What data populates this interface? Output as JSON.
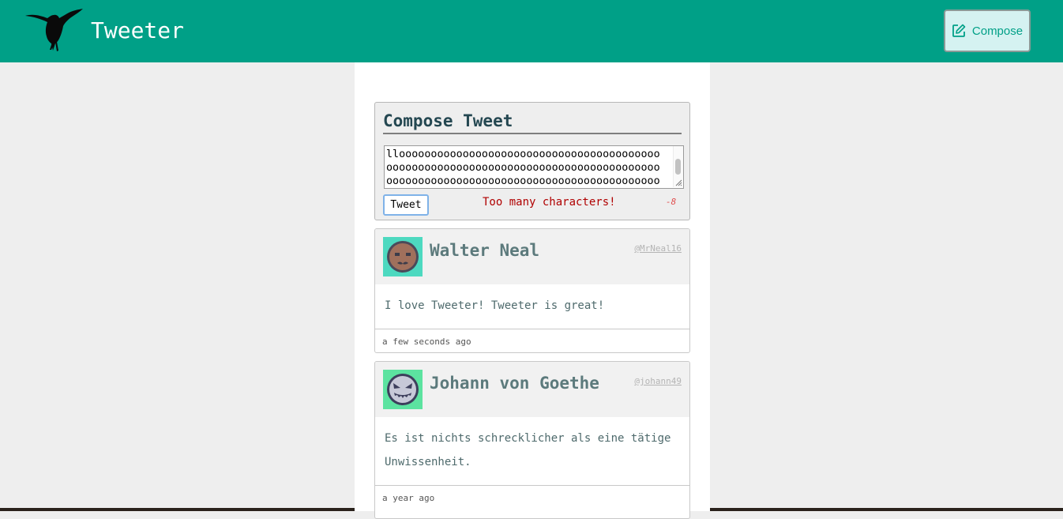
{
  "navbar": {
    "brand": "Tweeter",
    "logo_icon": "hummingbird-icon",
    "compose_icon": "edit-icon",
    "compose_label": "Compose",
    "background": "#00a087"
  },
  "compose": {
    "title": "Compose Tweet",
    "textarea_value": "llooooooooooooooooooooooooooooooooooooooooooooooooooooooooooooooooooooooooooooooooooooooooooooooooooooooooooooooooooooooooooooooooooooong tweet",
    "button_label": "Tweet",
    "error": "Too many characters!",
    "counter": "-8",
    "error_color": "#b00000"
  },
  "tweets": [
    {
      "name": "Walter Neal",
      "handle": "@MrNeal16",
      "text": "I love Tweeter! Tweeter is great!",
      "time": "a few seconds ago",
      "avatar_color": "#4dd9c0"
    },
    {
      "name": "Johann von Goethe",
      "handle": "@johann49",
      "text": "Es ist nichts schrecklicher als eine tätige Unwissenheit.",
      "time": "a year ago",
      "avatar_color": "#5ce3a0"
    }
  ]
}
